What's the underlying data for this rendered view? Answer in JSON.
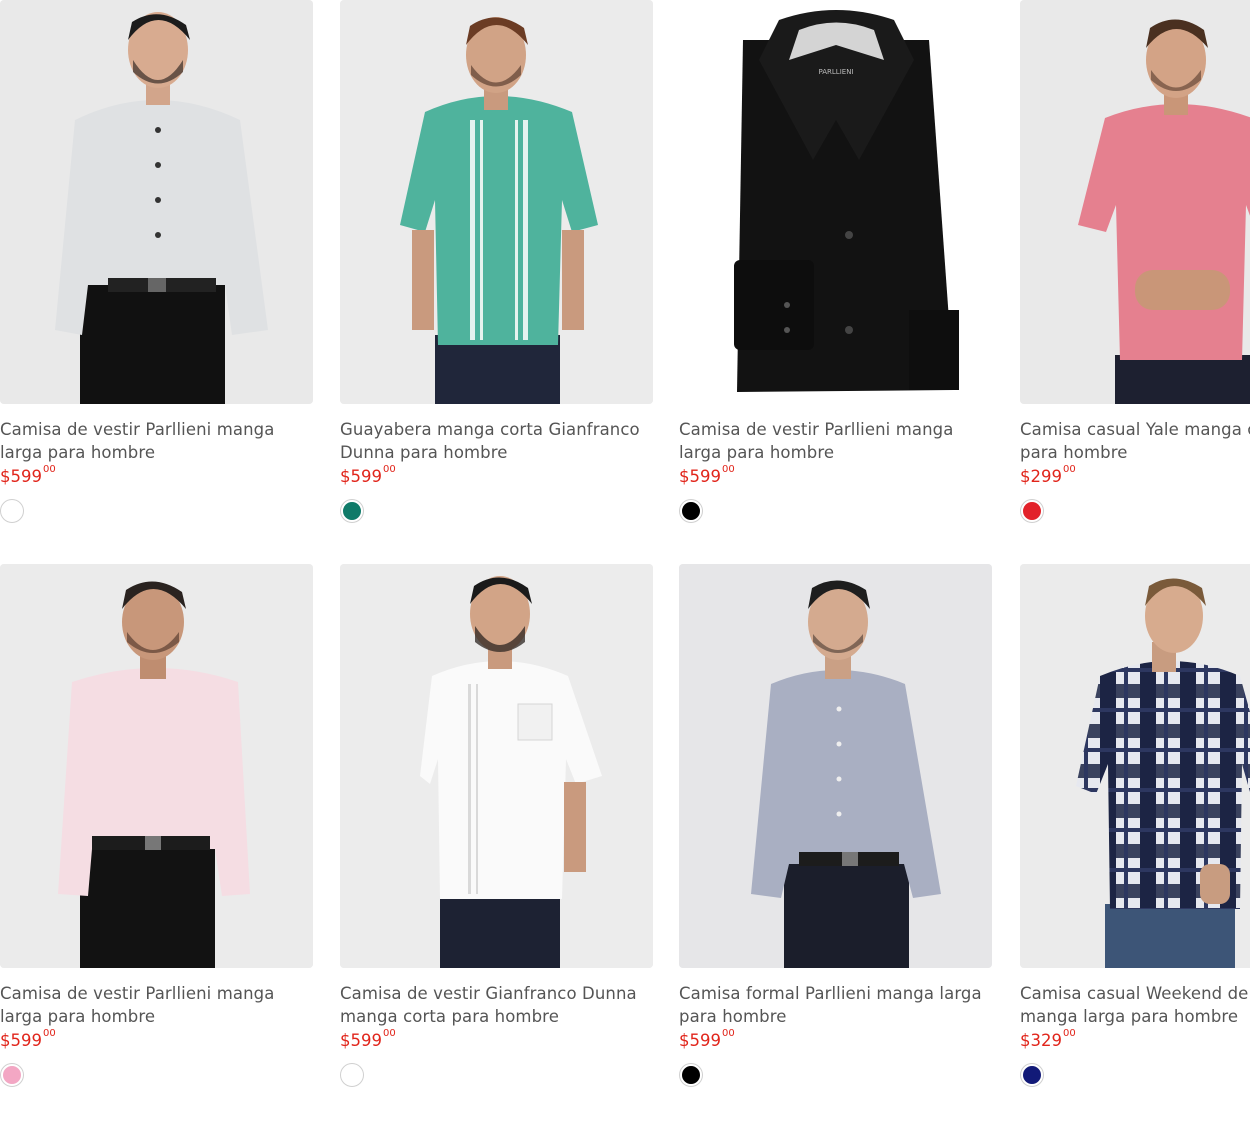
{
  "products": [
    {
      "title": "Camisa de vestir Parllieni manga larga para hombre",
      "price": "$599",
      "cents": "00",
      "swatch_color": "#ffffff",
      "image": "model-long-sleeve-grey-shirt"
    },
    {
      "title": "Guayabera manga corta Gianfranco Dunna para hombre",
      "price": "$599",
      "cents": "00",
      "swatch_color": "#0f7a68",
      "image": "model-short-sleeve-teal-guayabera"
    },
    {
      "title": "Camisa de vestir Parllieni manga larga para hombre",
      "price": "$599",
      "cents": "00",
      "swatch_color": "#000000",
      "image": "folded-black-dress-shirt",
      "label_text": "PARLLIENI"
    },
    {
      "title": "Camisa casual Yale manga corta para hombre",
      "price": "$299",
      "cents": "00",
      "swatch_color": "#e2222a",
      "image": "model-short-sleeve-pink-shirt"
    },
    {
      "title": "Camisa de vestir Parllieni manga larga para hombre",
      "price": "$599",
      "cents": "00",
      "swatch_color": "#f3a7c4",
      "image": "model-long-sleeve-pink-shirt"
    },
    {
      "title": "Camisa de vestir Gianfranco Dunna manga corta para hombre",
      "price": "$599",
      "cents": "00",
      "swatch_color": "#ffffff",
      "image": "model-short-sleeve-white-shirt"
    },
    {
      "title": "Camisa formal Parllieni manga larga para hombre",
      "price": "$599",
      "cents": "00",
      "swatch_color": "#000000",
      "image": "model-long-sleeve-grey-blue-shirt"
    },
    {
      "title": "Camisa casual Weekend de algodón manga larga para hombre",
      "price": "$329",
      "cents": "00",
      "swatch_color": "#121a78",
      "image": "model-long-sleeve-plaid-shirt"
    }
  ]
}
